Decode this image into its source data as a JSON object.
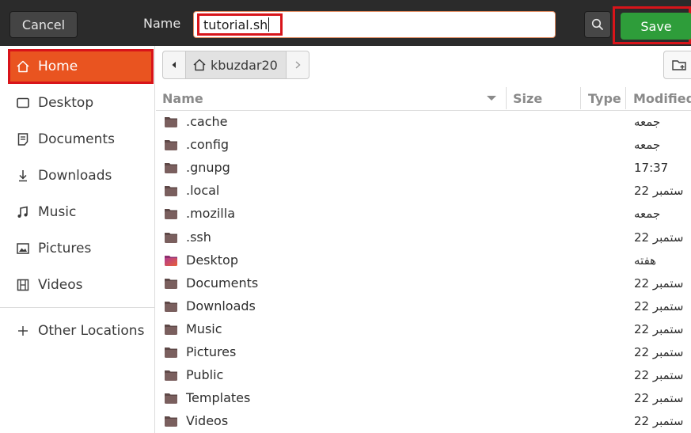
{
  "header": {
    "cancel_label": "Cancel",
    "name_label": "Name",
    "filename_value": "tutorial.sh",
    "save_label": "Save"
  },
  "sidebar": {
    "items": [
      {
        "label": "Home",
        "icon": "home-icon",
        "active": true
      },
      {
        "label": "Desktop",
        "icon": "desktop-icon"
      },
      {
        "label": "Documents",
        "icon": "documents-icon"
      },
      {
        "label": "Downloads",
        "icon": "downloads-icon"
      },
      {
        "label": "Music",
        "icon": "music-icon"
      },
      {
        "label": "Pictures",
        "icon": "pictures-icon"
      },
      {
        "label": "Videos",
        "icon": "videos-icon"
      }
    ],
    "other_locations": "Other Locations"
  },
  "pathbar": {
    "current": "kbuzdar20"
  },
  "columns": {
    "name": "Name",
    "size": "Size",
    "type": "Type",
    "modified": "Modified"
  },
  "files": [
    {
      "name": ".cache",
      "modified": "جمعه"
    },
    {
      "name": ".config",
      "modified": "جمعه"
    },
    {
      "name": ".gnupg",
      "modified": "17:37"
    },
    {
      "name": ".local",
      "modified": "22 ستمبر"
    },
    {
      "name": ".mozilla",
      "modified": "جمعه"
    },
    {
      "name": ".ssh",
      "modified": "22 ستمبر"
    },
    {
      "name": "Desktop",
      "modified": "هفته",
      "special": true
    },
    {
      "name": "Documents",
      "modified": "22 ستمبر"
    },
    {
      "name": "Downloads",
      "modified": "22 ستمبر"
    },
    {
      "name": "Music",
      "modified": "22 ستمبر"
    },
    {
      "name": "Pictures",
      "modified": "22 ستمبر"
    },
    {
      "name": "Public",
      "modified": "22 ستمبر"
    },
    {
      "name": "Templates",
      "modified": "22 ستمبر"
    },
    {
      "name": "Videos",
      "modified": "22 ستمبر"
    }
  ],
  "colors": {
    "accent": "#e95420",
    "save": "#2e9d3a",
    "highlight": "#d8141a",
    "header_bg": "#2b2b2b"
  }
}
